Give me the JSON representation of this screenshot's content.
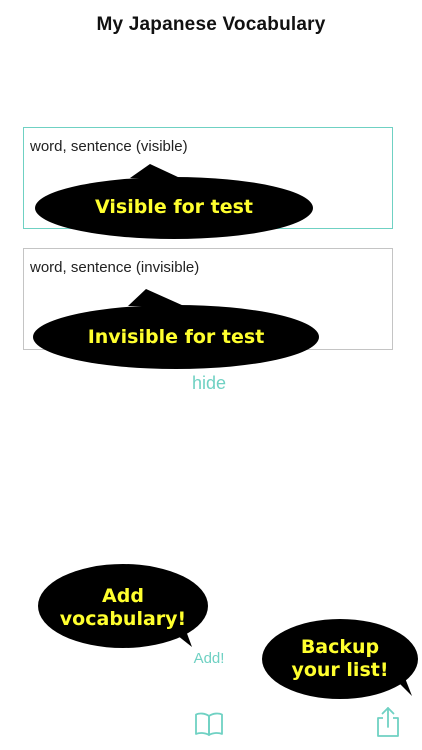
{
  "header": {
    "title": "My Japanese Vocabulary"
  },
  "fields": {
    "visible_placeholder": "word, sentence (visible)",
    "invisible_placeholder": "word, sentence (invisible)"
  },
  "actions": {
    "hide_label": "hide",
    "add_label": "Add!"
  },
  "callouts": {
    "visible": "Visible for test",
    "invisible": "Invisible for test",
    "add_line1": "Add",
    "add_line2": "vocabulary!",
    "backup_line1": "Backup",
    "backup_line2": "your list!"
  },
  "tabbar": {
    "left_icon": "book-icon",
    "right_icon": "share-icon"
  },
  "colors": {
    "accent": "#6fd1c3",
    "callout_bg": "#000000",
    "callout_text": "#ffff2e",
    "border_inactive": "#c4c4c4"
  }
}
